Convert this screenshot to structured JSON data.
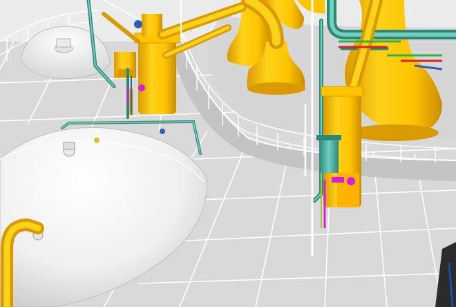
{
  "scene": {
    "kind": "3d-plant-model-render",
    "palette": {
      "background": "#ffffff",
      "floor": "#d9d9d9",
      "floor_dark": "#c9c9c9",
      "grid_line": "#ffffff",
      "vessel_white": "#f2f2f2",
      "vessel_shade": "#cfcfcf",
      "pipe_yellow": "#ffc400",
      "pipe_yellow_dark": "#d99a00",
      "pipe_teal": "#4fb8a8",
      "pipe_teal_dark": "#2f8677",
      "pipe_blue": "#2d5fb0",
      "pipe_green": "#2db34a",
      "pipe_magenta": "#d61fd6",
      "pipe_red": "#e02020",
      "railing": "#ffffff",
      "column_dark": "#3a3a3a"
    },
    "objects": [
      "floor-grid",
      "upper-platform",
      "railing",
      "white-vessel-small",
      "white-vessel-large",
      "yellow-stills",
      "yellow-condenser",
      "teal-pipes",
      "yellow-pipes",
      "instrument-valves"
    ]
  }
}
